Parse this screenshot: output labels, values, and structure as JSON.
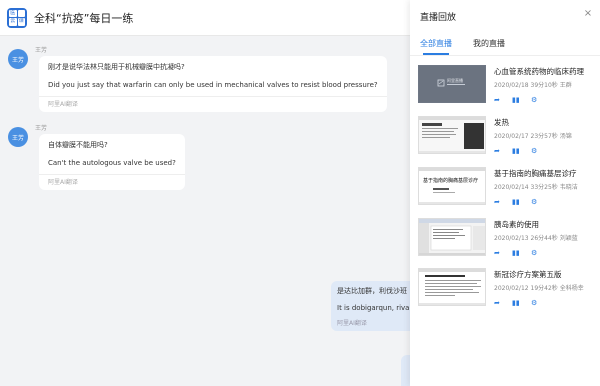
{
  "header": {
    "logo_chars": [
      "医",
      "",
      "云",
      "课"
    ],
    "title": "全科“抗疫”每日一练"
  },
  "chat": {
    "messages": [
      {
        "sender": "王芳",
        "avatar_text": "王芳",
        "text_zh": "刚才是说华法林只能用于机械瓣膜中抗凝吗?",
        "text_en": "Did you just say that warfarin can only be used in mechanical valves to resist blood pressure?",
        "translated_by": "阿里AI翻译"
      },
      {
        "sender": "王芳",
        "avatar_text": "王芳",
        "text_zh": "自体瓣膜不能用吗?",
        "text_en": "Can't the autologous valve be used?",
        "translated_by": "阿里AI翻译"
      }
    ],
    "outgoing": {
      "text_zh": "是达比加群，利伐沙班",
      "text_en": "It is dobigarqun, rivaro",
      "translated_by": "阿里AI翻译"
    }
  },
  "panel": {
    "title": "直播回放",
    "close_label": "×",
    "tabs": [
      {
        "label": "全部直播",
        "active": true
      },
      {
        "label": "我的直播",
        "active": false
      }
    ],
    "items": [
      {
        "title": "心血管系统药物的临床药理",
        "date": "2020/02/18",
        "duration": "39分10秒",
        "speaker": "王群",
        "thumb": "dark",
        "thumb_text": "阿里直播",
        "icons": [
          "share-icon",
          "stats-icon",
          "settings-icon"
        ]
      },
      {
        "title": "发热",
        "date": "2020/02/17",
        "duration": "23分57秒",
        "speaker": "汤锦",
        "thumb": "slide",
        "thumb_text": "",
        "icons": [
          "share-icon",
          "stats-icon",
          "settings-icon"
        ]
      },
      {
        "title": "基于指南的胸痛基层诊疗",
        "date": "2020/02/14",
        "duration": "33分25秒",
        "speaker": "韦晓洁",
        "thumb": "title",
        "thumb_text": "基于指南的胸痛基层诊疗",
        "icons": [
          "share-icon",
          "stats-icon",
          "settings-icon"
        ]
      },
      {
        "title": "胰岛素的使用",
        "date": "2020/02/13",
        "duration": "26分44秒",
        "speaker": "刘颖蓝",
        "thumb": "software",
        "thumb_text": "",
        "icons": [
          "share-icon",
          "stats-icon",
          "settings-icon"
        ]
      },
      {
        "title": "新冠诊疗方案第五版",
        "date": "2020/02/12",
        "duration": "19分42秒",
        "speaker": "全科杨幸",
        "thumb": "document",
        "thumb_text": "",
        "icons": [
          "share-icon",
          "stats-icon",
          "settings-icon"
        ]
      }
    ]
  },
  "colors": {
    "accent": "#2b7de1",
    "avatar": "#4a90e2",
    "outgoing_bubble": "#dfe9f7"
  }
}
